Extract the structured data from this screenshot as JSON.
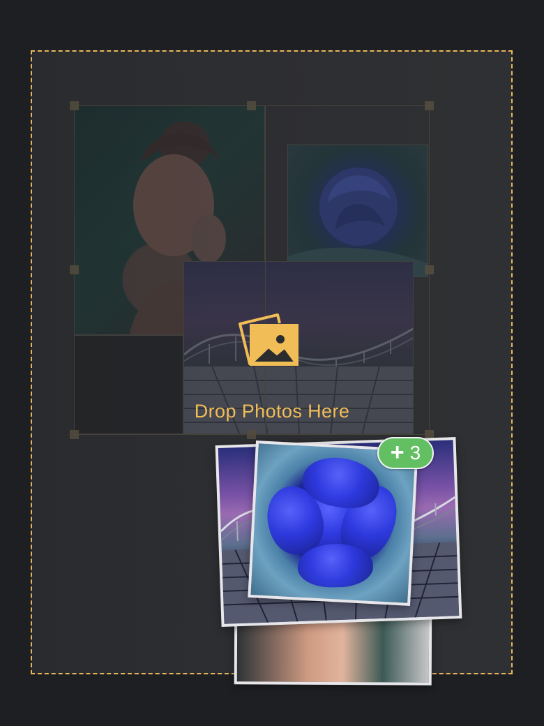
{
  "drop_area": {
    "label": "Drop Photos Here",
    "icon": "photos-stack-icon",
    "border_color": "#e8b75a"
  },
  "drag_preview": {
    "count_badge": "3",
    "badge_color": "#62bf62",
    "icon": "plus-icon"
  },
  "canvas": {
    "layout": "collage-grid"
  }
}
